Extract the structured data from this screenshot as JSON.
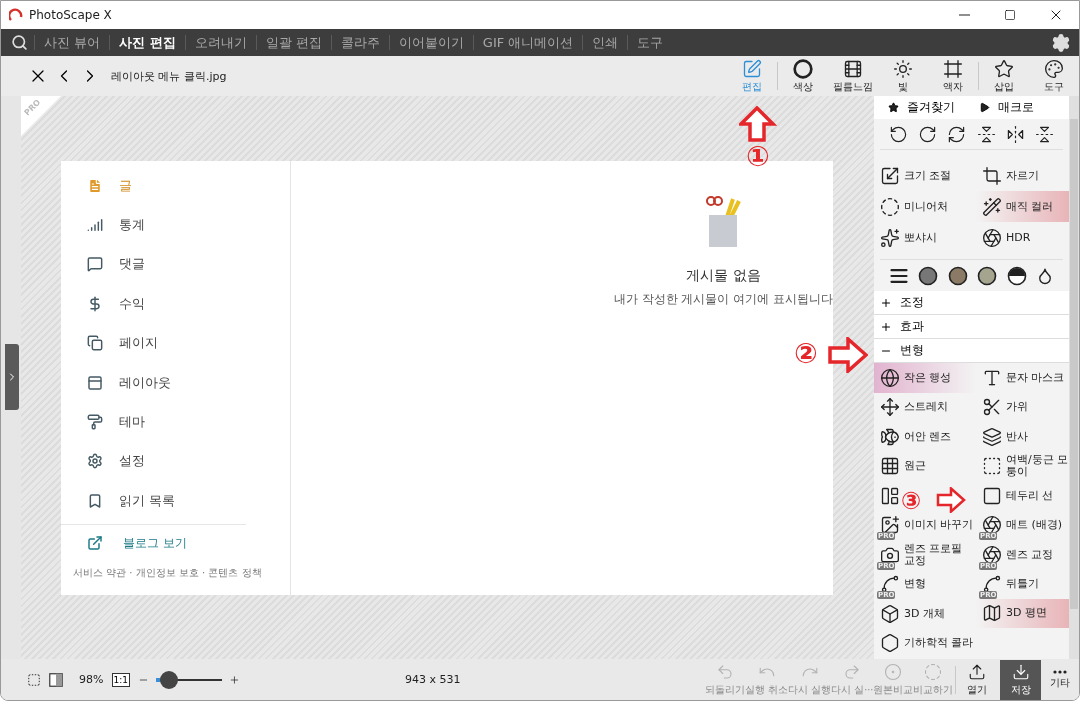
{
  "window": {
    "title": "PhotoScape X"
  },
  "menu": [
    {
      "label": "사진 뷰어",
      "selected": false
    },
    {
      "label": "사진 편집",
      "selected": true
    },
    {
      "label": "오려내기",
      "selected": false
    },
    {
      "label": "일괄 편집",
      "selected": false
    },
    {
      "label": "콜라주",
      "selected": false
    },
    {
      "label": "이어붙이기",
      "selected": false
    },
    {
      "label": "GIF 애니메이션",
      "selected": false
    },
    {
      "label": "인쇄",
      "selected": false
    },
    {
      "label": "도구",
      "selected": false
    }
  ],
  "toolbar": {
    "filename": "레이아웃 메뉴 클릭.jpg",
    "tools": [
      {
        "label": "편집",
        "selected": true
      },
      {
        "label": "색상",
        "selected": false
      },
      {
        "label": "필름느낌",
        "selected": false
      },
      {
        "label": "빛",
        "selected": false
      },
      {
        "label": "액자",
        "selected": false
      },
      {
        "label": "삽입",
        "selected": false
      },
      {
        "label": "도구",
        "selected": false
      }
    ]
  },
  "canvas": {
    "corner_badge": "PRO",
    "image": {
      "sidebar": [
        {
          "label": "글",
          "selected": true
        },
        {
          "label": "통계",
          "selected": false
        },
        {
          "label": "댓글",
          "selected": false
        },
        {
          "label": "수익",
          "selected": false
        },
        {
          "label": "페이지",
          "selected": false
        },
        {
          "label": "레이아웃",
          "selected": false
        },
        {
          "label": "테마",
          "selected": false
        },
        {
          "label": "설정",
          "selected": false
        },
        {
          "label": "읽기 목록",
          "selected": false
        }
      ],
      "blog_link": "블로그 보기",
      "footer": "서비스 약관 · 개인정보 보호 · 콘텐츠 정책",
      "empty_title": "게시물 없음",
      "empty_text": "내가 작성한 게시물이 여기에 표시됩니다"
    },
    "annotations": [
      {
        "mark": "①"
      },
      {
        "mark": "②"
      },
      {
        "mark": "③"
      }
    ]
  },
  "panel": {
    "favorites": "즐겨찾기",
    "macro": "매크로",
    "tools": [
      {
        "label": "크기 조절",
        "highlighted": false
      },
      {
        "label": "자르기",
        "highlighted": false
      },
      {
        "label": "미니어처",
        "highlighted": false
      },
      {
        "label": "매직 컬러",
        "highlighted": true
      },
      {
        "label": "뽀샤시",
        "highlighted": false
      },
      {
        "label": "HDR",
        "highlighted": false
      }
    ],
    "sections": [
      {
        "label": "조정",
        "expanded": false
      },
      {
        "label": "효과",
        "expanded": false
      },
      {
        "label": "변형",
        "expanded": true,
        "items": [
          {
            "label": "작은 행성",
            "highlighted": true
          },
          {
            "label": "문자 마스크",
            "highlighted": false
          },
          {
            "label": "스트레치",
            "highlighted": false
          },
          {
            "label": "가위",
            "highlighted": false
          },
          {
            "label": "어안 렌즈",
            "highlighted": false
          },
          {
            "label": "반사",
            "highlighted": false
          },
          {
            "label": "원근",
            "highlighted": false
          },
          {
            "label": "여백/둥근 모퉁이",
            "highlighted": false
          },
          {
            "highlighted": false
          },
          {
            "label": "테두리 선",
            "highlighted": false
          },
          {
            "label": "이미지 바꾸기",
            "highlighted": false,
            "badge": "PRO"
          },
          {
            "label": "매트 (배경)",
            "highlighted": false,
            "badge": "PRO"
          },
          {
            "label": "렌즈 프로필 교정",
            "highlighted": false,
            "badge": "PRO"
          },
          {
            "label": "렌즈 교정",
            "highlighted": false,
            "badge": "PRO"
          },
          {
            "label": "변형",
            "highlighted": false,
            "badge": "PRO"
          },
          {
            "label": "뒤틀기",
            "highlighted": false,
            "badge": "PRO"
          },
          {
            "label": "3D 개체",
            "highlighted": false
          },
          {
            "label": "3D 평면",
            "highlighted": true
          },
          {
            "label": "기하학적 콜라",
            "highlighted": false
          }
        ]
      }
    ]
  },
  "status": {
    "zoom": "98%",
    "actual": "1:1",
    "level": 0.2,
    "size": "943 x 531",
    "actions": [
      {
        "label": "되돌리기",
        "disabled": true
      },
      {
        "label": "실행 취소",
        "disabled": true
      },
      {
        "label": "다시 실행",
        "disabled": true
      },
      {
        "label": "다시 실···",
        "disabled": true
      },
      {
        "label": "원본비교",
        "disabled": true
      },
      {
        "label": "비교하기",
        "disabled": true
      }
    ],
    "open": "열기",
    "save": "저장",
    "more": "기타"
  }
}
